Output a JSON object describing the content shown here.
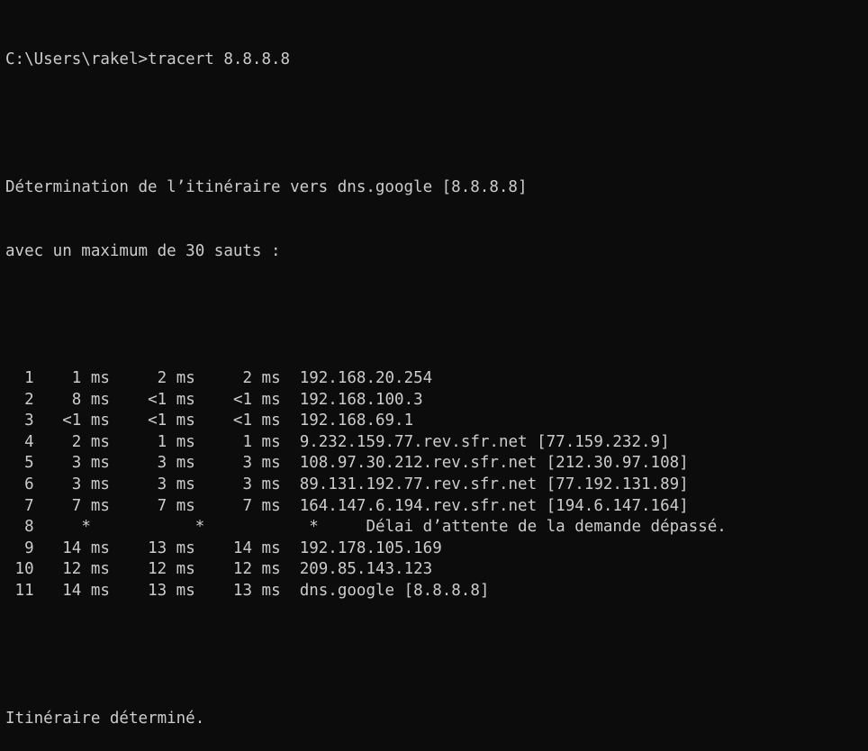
{
  "window": {
    "background": "#0c0c0c",
    "foreground": "#cccccc"
  },
  "prompt_line": "C:\\Users\\rakel>tracert 8.8.8.8",
  "header": {
    "line1": "Détermination de l’itinéraire vers dns.google [8.8.8.8]",
    "line2": "avec un maximum de 30 sauts :"
  },
  "hops": [
    {
      "n": "1",
      "t1": "1 ms",
      "t2": "2 ms",
      "t3": "2 ms",
      "host": "192.168.20.254"
    },
    {
      "n": "2",
      "t1": "8 ms",
      "t2": "<1 ms",
      "t3": "<1 ms",
      "host": "192.168.100.3"
    },
    {
      "n": "3",
      "t1": "<1 ms",
      "t2": "<1 ms",
      "t3": "<1 ms",
      "host": "192.168.69.1"
    },
    {
      "n": "4",
      "t1": "2 ms",
      "t2": "1 ms",
      "t3": "1 ms",
      "host": "9.232.159.77.rev.sfr.net [77.159.232.9]"
    },
    {
      "n": "5",
      "t1": "3 ms",
      "t2": "3 ms",
      "t3": "3 ms",
      "host": "108.97.30.212.rev.sfr.net [212.30.97.108]"
    },
    {
      "n": "6",
      "t1": "3 ms",
      "t2": "3 ms",
      "t3": "3 ms",
      "host": "89.131.192.77.rev.sfr.net [77.192.131.89]"
    },
    {
      "n": "7",
      "t1": "7 ms",
      "t2": "7 ms",
      "t3": "7 ms",
      "host": "164.147.6.194.rev.sfr.net [194.6.147.164]"
    },
    {
      "n": "8",
      "t1": "*",
      "t2": "*",
      "t3": "*",
      "host": "Délai d’attente de la demande dépassé."
    },
    {
      "n": "9",
      "t1": "14 ms",
      "t2": "13 ms",
      "t3": "14 ms",
      "host": "192.178.105.169"
    },
    {
      "n": "10",
      "t1": "12 ms",
      "t2": "12 ms",
      "t3": "12 ms",
      "host": "209.85.143.123"
    },
    {
      "n": "11",
      "t1": "14 ms",
      "t2": "13 ms",
      "t3": "13 ms",
      "host": "dns.google [8.8.8.8]"
    }
  ],
  "footer": "Itinéraire déterminé."
}
